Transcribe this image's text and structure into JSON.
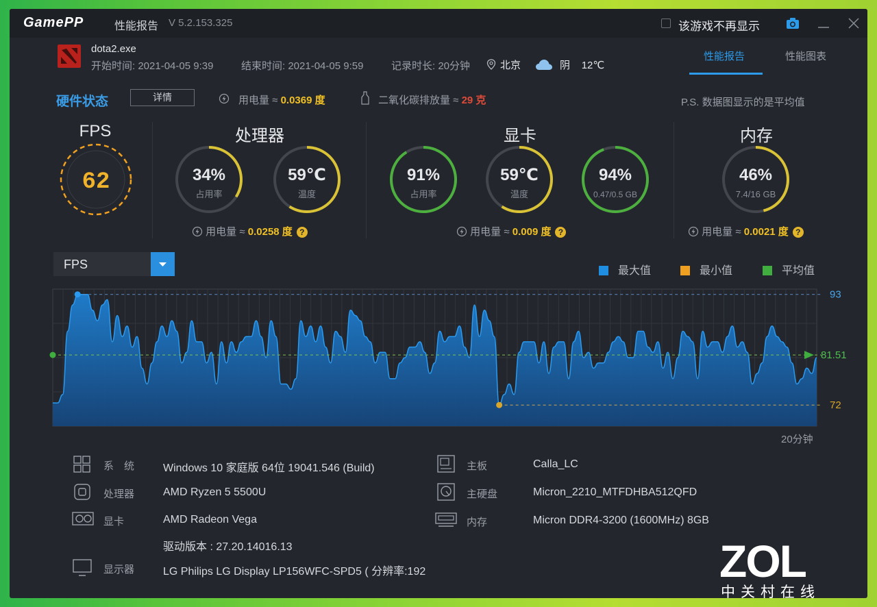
{
  "window": {
    "logo": "GamePP",
    "title": "性能报告",
    "version": "V 5.2.153.325",
    "hide_game_label": "该游戏不再显示"
  },
  "session": {
    "process": "dota2.exe",
    "start": "开始时间: 2021-04-05 9:39",
    "end": "结束时间: 2021-04-05 9:59",
    "duration": "记录时长: 20分钟",
    "city": "北京",
    "weather": "阴",
    "temp": "12℃"
  },
  "tabs": {
    "active": "性能报告",
    "other": "性能图表"
  },
  "summary": {
    "hw_title": "硬件状态",
    "detail_button": "详情",
    "power_label": "用电量 ≈",
    "power_value": "0.0369 度",
    "co2_label": "二氧化碳排放量 ≈",
    "co2_value": "29 克",
    "note": "P.S. 数据图显示的是平均值"
  },
  "fps": {
    "title": "FPS",
    "value": "62"
  },
  "cpu": {
    "title": "处理器",
    "usage": "34%",
    "usage_label": "占用率",
    "usage_frac": 0.34,
    "temp": "59℃",
    "temp_label": "温度",
    "temp_frac": 0.59,
    "power_label": "用电量 ≈",
    "power_value": "0.0258 度"
  },
  "gpu": {
    "title": "显卡",
    "usage": "91%",
    "usage_label": "占用率",
    "usage_frac": 0.91,
    "temp": "59℃",
    "temp_label": "温度",
    "temp_frac": 0.59,
    "vram": "94%",
    "vram_label": "0.47/0.5 GB",
    "vram_frac": 0.94,
    "power_label": "用电量 ≈",
    "power_value": "0.009 度"
  },
  "memory": {
    "title": "内存",
    "usage": "46%",
    "usage_label": "7.4/16 GB",
    "usage_frac": 0.46,
    "power_label": "用电量 ≈",
    "power_value": "0.0021 度"
  },
  "colors": {
    "accent": "#2c9bea",
    "max": "#1f8de0",
    "min": "#f0a020",
    "avg": "#3fae3f",
    "gauge_green": "#4caf3e",
    "gauge_yellow": "#d9c235"
  },
  "metric_select": "FPS",
  "legend": {
    "max": "最大值",
    "min": "最小值",
    "avg": "平均值"
  },
  "chart_data": {
    "type": "area",
    "title": "",
    "xlabel": "20分钟",
    "ylabel": "",
    "ylim": [
      68,
      94
    ],
    "max_label": "93",
    "avg_label": "81.51",
    "min_label": "72",
    "max": 93,
    "avg": 81.51,
    "min": 72,
    "series": [
      {
        "values": [
          72.4,
          72.4,
          74,
          86,
          91,
          93,
          93,
          93,
          90,
          88,
          91,
          92,
          84,
          89,
          85,
          87,
          83,
          85,
          79,
          76,
          80,
          84,
          87,
          85,
          88,
          86,
          80,
          82,
          88,
          84,
          84,
          80,
          82,
          76,
          84,
          80,
          84,
          82,
          84,
          85,
          85,
          88,
          85,
          81,
          88,
          85,
          76,
          76,
          75,
          77,
          88,
          85,
          87,
          84,
          87,
          83,
          80,
          86,
          85,
          82,
          90,
          89,
          88,
          85,
          84,
          80,
          82,
          82,
          77,
          77,
          80,
          81,
          83,
          83,
          84,
          82,
          78,
          80,
          86,
          84,
          85,
          85,
          87,
          83,
          81,
          91,
          85,
          90,
          88,
          85,
          72,
          74,
          76,
          74,
          82,
          84,
          84,
          84,
          80,
          84,
          78,
          83,
          84,
          84,
          77,
          84,
          86,
          81,
          82,
          79,
          80,
          80,
          82,
          84,
          85,
          84,
          81,
          81,
          86,
          86,
          83,
          82,
          84,
          79,
          82,
          77,
          81,
          86,
          85,
          84,
          77,
          86,
          83,
          84,
          84,
          82,
          85,
          87,
          83,
          84,
          82,
          76,
          78,
          80,
          85,
          87,
          85,
          84,
          83,
          80,
          76,
          77,
          79,
          78,
          81
        ],
        "x_note": "samples across 20 minutes"
      }
    ]
  },
  "system": {
    "os_key": "系　统",
    "os": "Windows 10 家庭版 64位   19041.546 (Build)",
    "cpu_key": "处理器",
    "cpu": "AMD Ryzen 5 5500U",
    "gpu_key": "显卡",
    "gpu": "AMD Radeon Vega",
    "driver": "驱动版本 : 27.20.14016.13",
    "display_key": "显示器",
    "display": "LG Philips LG Display LP156WFC-SPD5 ( 分辨率:192",
    "board_key": "主板",
    "board": "Calla_LC",
    "disk_key": "主硬盘",
    "disk": "Micron_2210_MTFDHBA512QFD",
    "mem_key": "内存",
    "mem": "Micron DDR4-3200 (1600MHz) 8GB"
  },
  "watermark": {
    "main": "ZOL",
    "sub": "中关村在线"
  }
}
